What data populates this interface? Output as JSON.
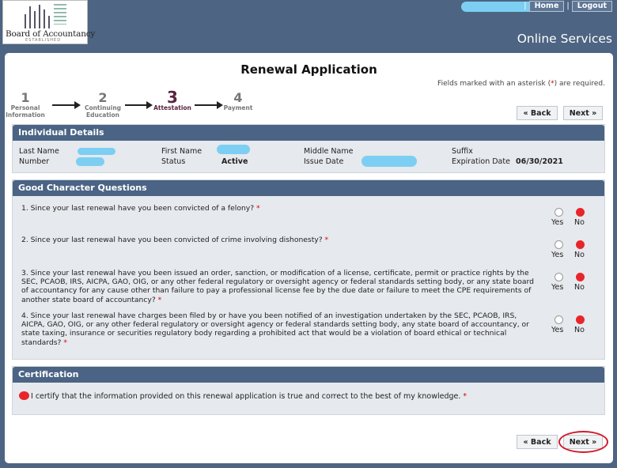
{
  "header": {
    "logo_text": "Board of Accountancy",
    "logo_subtext": "ESTABLISHED",
    "nav_separator": "|",
    "home_label": "Home",
    "logout_label": "Logout",
    "online_services": "Online Services"
  },
  "page": {
    "title": "Renewal Application",
    "required_note_pre": "Fields marked with an asterisk (",
    "required_star": "*",
    "required_note_post": ") are required."
  },
  "steps": [
    {
      "num": "1",
      "label_line1": "Personal",
      "label_line2": "Information",
      "active": false
    },
    {
      "num": "2",
      "label_line1": "Continuing",
      "label_line2": "Education",
      "active": false
    },
    {
      "num": "3",
      "label_line1": "Attestation",
      "label_line2": "",
      "active": true
    },
    {
      "num": "4",
      "label_line1": "Payment",
      "label_line2": "",
      "active": false
    }
  ],
  "buttons": {
    "back": "« Back",
    "next": "Next »"
  },
  "individual": {
    "heading": "Individual Details",
    "last_name_label": "Last Name",
    "first_name_label": "First Name",
    "middle_name_label": "Middle Name",
    "suffix_label": "Suffix",
    "number_label": "Number",
    "status_label": "Status",
    "status_value": "Active",
    "issue_date_label": "Issue Date",
    "expiration_label": "Expiration Date",
    "expiration_value": "06/30/2021"
  },
  "character": {
    "heading": "Good Character Questions",
    "yes_label": "Yes",
    "no_label": "No",
    "questions": [
      {
        "text": "1. Since your last renewal have you been convicted of a felony?",
        "answer": "No"
      },
      {
        "text": "2. Since your last renewal have you been convicted of crime involving dishonesty?",
        "answer": "No"
      },
      {
        "text": "3. Since your last renewal have you been issued an order, sanction, or modification of a license, certificate, permit or practice rights by the SEC, PCAOB, IRS, AICPA, GAO, OIG, or any other federal regulatory or oversight agency or federal standards setting body, or any state board of accountancy for any cause other than failure to pay a professional license fee by the due date or failure to meet the CPE requirements of another state board of accountancy?",
        "answer": "No"
      },
      {
        "text": "4. Since your last renewal have charges been filed by or have you been notified of an investigation undertaken by the SEC, PCAOB, IRS, AICPA, GAO, OIG, or any other federal regulatory or oversight agency or federal standards setting body, any state board of accountancy, or state taxing, insurance or securities regulatory body regarding a prohibited act that would be a violation of board ethical or technical standards?",
        "answer": "No"
      }
    ]
  },
  "certification": {
    "heading": "Certification",
    "text": "I certify that the information provided on this renewal application is true and correct to the best of my knowledge.",
    "checked": true
  },
  "colors": {
    "header_bg": "#4d6482",
    "section_header": "#4b6485",
    "selected_radio": "#e8262a",
    "active_step": "#5a2540",
    "highlight_circle": "#d01a2a"
  }
}
